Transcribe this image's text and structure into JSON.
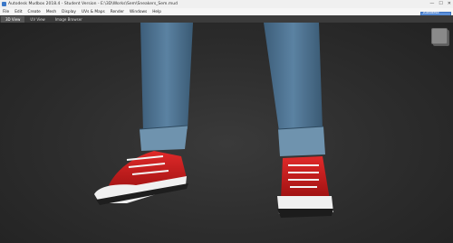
{
  "window": {
    "title": "Autodesk Mudbox 2018.4 - Student Version - E:\\3D\\Works\\Sem\\Sneakers_Sem.mud",
    "controls": [
      "—",
      "☐",
      "✕"
    ]
  },
  "menu": {
    "items": [
      "File",
      "Edit",
      "Create",
      "Mesh",
      "Display",
      "UVs & Maps",
      "Render",
      "Windows",
      "Help"
    ]
  },
  "tabs": [
    {
      "label": "3D View"
    },
    {
      "label": "UV View"
    },
    {
      "label": "Image Browser"
    }
  ],
  "search": {
    "label": "Autodesk Subscriptions"
  },
  "colors": {
    "accent": "#5a8ed8",
    "viewport_bg": "#2c2c2c",
    "jeans": "#4e7390",
    "sneaker": "#c81a1a",
    "sole": "#f2f2f2"
  },
  "icons": [
    "app-icon",
    "viewcube-icon"
  ]
}
